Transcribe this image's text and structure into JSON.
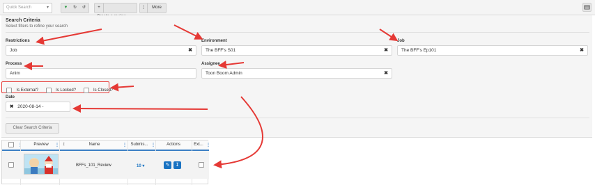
{
  "toolbar": {
    "quick_search_placeholder": "Quick Search",
    "create_review_label": "Create a review",
    "more_label": "More"
  },
  "search_criteria": {
    "title": "Search Criteria",
    "subtitle": "Select filters to refine your search",
    "restrictions": {
      "label": "Restrictions",
      "value": "Job"
    },
    "environment": {
      "label": "Environment",
      "value": "The BFF's S01"
    },
    "job": {
      "label": "Job",
      "value": "The BFF's Ep101"
    },
    "process": {
      "label": "Process",
      "value": "Anim"
    },
    "assignee": {
      "label": "Assignee",
      "value": "Toon Boom Admin"
    },
    "checkboxes": [
      {
        "label": "Is External?",
        "checked": false
      },
      {
        "label": "Is Locked?",
        "checked": false
      },
      {
        "label": "Is Closed?",
        "checked": false
      }
    ],
    "date": {
      "label": "Date",
      "value": "2020-08-14 -"
    },
    "clear_label": "Clear Search Criteria"
  },
  "grid": {
    "headers": {
      "preview": "Preview",
      "name": "Name",
      "submissions": "Submis...",
      "actions": "Actions",
      "external": "Ext..."
    },
    "rows": [
      {
        "name": "BFFs_101_Review",
        "submissions": "10"
      }
    ]
  },
  "colors": {
    "accent": "#1a73c2",
    "annotation": "#e53935",
    "panel": "#f5f5f5"
  }
}
